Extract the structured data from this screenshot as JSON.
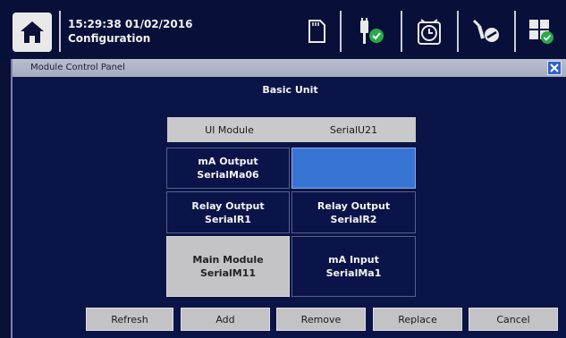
{
  "status_bar": {
    "time_date": "15:29:38 01/02/2016",
    "screen_name": "Configuration",
    "icons": [
      "home-icon",
      "sd-card-icon",
      "plug-check-icon",
      "alarm-clock-icon",
      "wrench-screwdriver-icon",
      "modules-icon"
    ]
  },
  "panel": {
    "title": "Module Control Panel",
    "heading": "Basic Unit",
    "ui_module": {
      "name": "UI Module",
      "serial": "SerialU21"
    },
    "modules": [
      {
        "line1": "mA Output",
        "line2": "SerialMa06",
        "state": "dark"
      },
      {
        "line1": "",
        "line2": "",
        "state": "selected"
      },
      {
        "line1": "Relay Output",
        "line2": "SerialR1",
        "state": "dark"
      },
      {
        "line1": "Relay Output",
        "line2": "SerialR2",
        "state": "dark"
      },
      {
        "line1": "Main Module",
        "line2": "SerialM11",
        "state": "grey"
      },
      {
        "line1": "mA Input",
        "line2": "SerialMa1",
        "state": "dark"
      }
    ]
  },
  "buttons": {
    "refresh": "Refresh",
    "add": "Add",
    "remove": "Remove",
    "replace": "Replace",
    "cancel": "Cancel"
  },
  "colors": {
    "background": "#0b1136",
    "panel": "#0a1446",
    "selected_cell": "#3874d4",
    "button": "#c3c3c6",
    "close_button": "#2e63c8",
    "status_ok": "#2aa84a"
  }
}
